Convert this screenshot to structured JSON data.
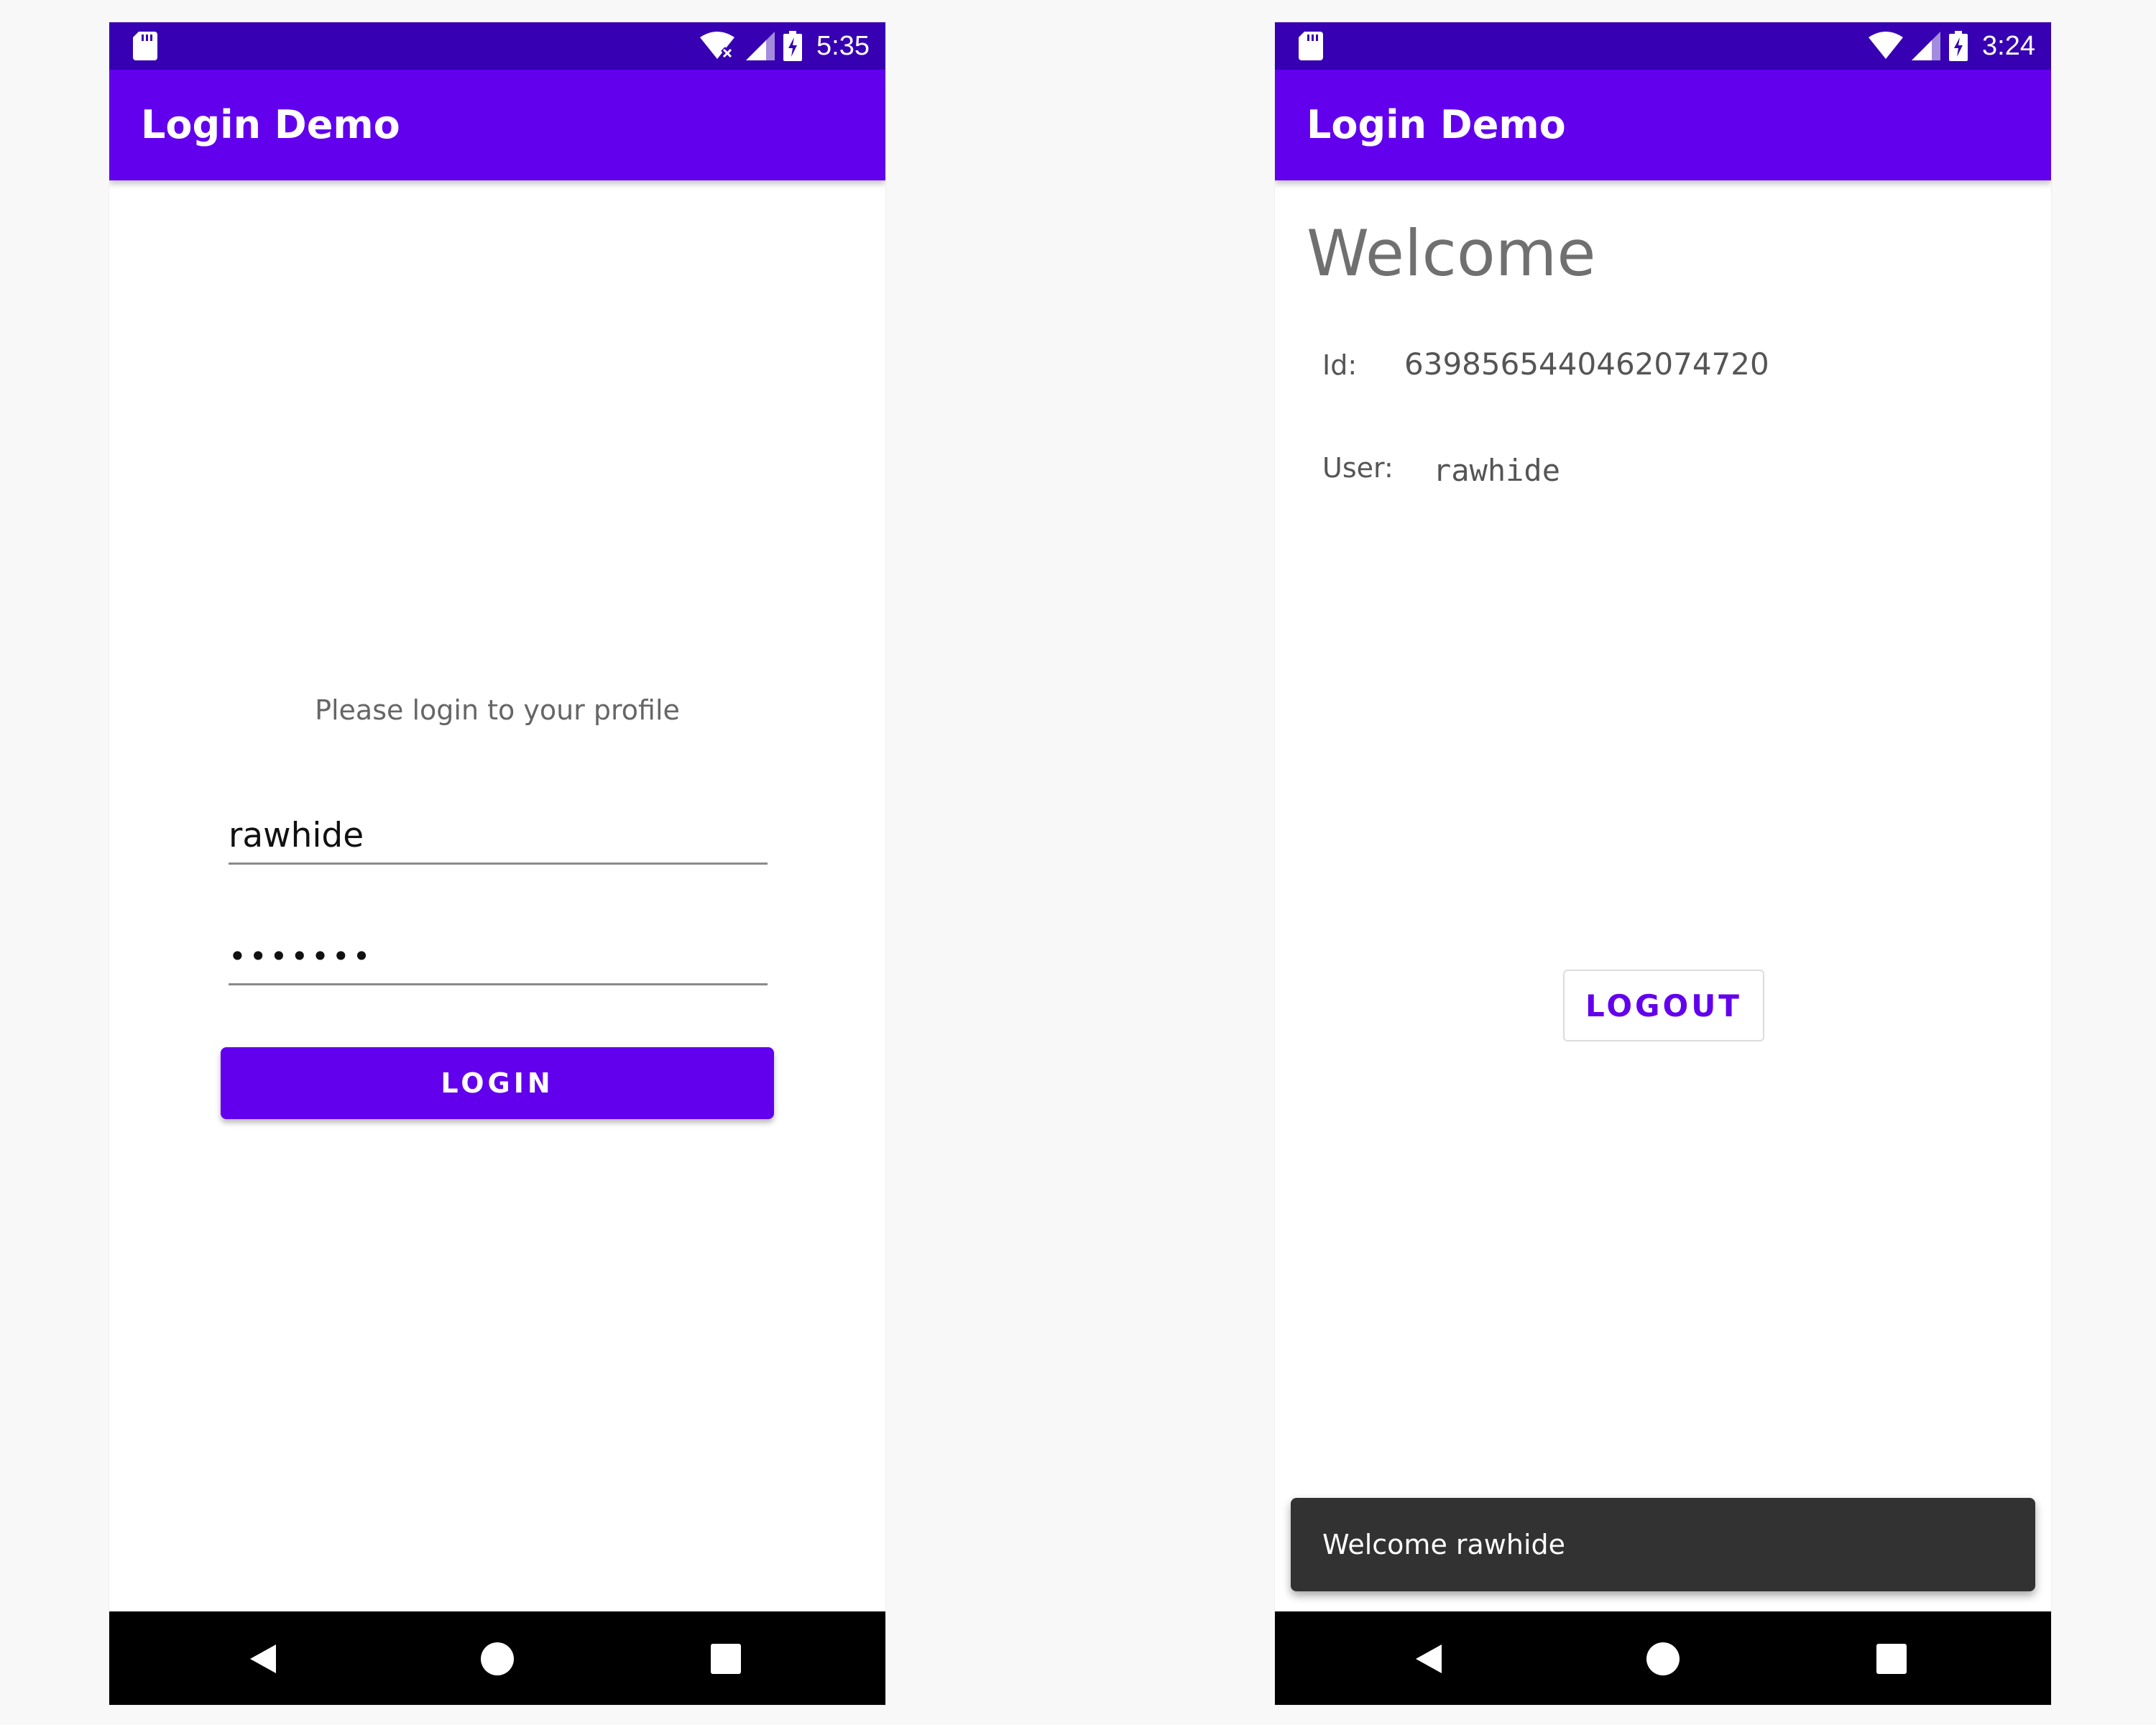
{
  "colors": {
    "status_bar": "#3700b3",
    "app_bar": "#6200ee",
    "accent": "#6200ee",
    "snackbar": "#323232",
    "nav_bar": "#000000"
  },
  "login_screen": {
    "status": {
      "time": "5:35",
      "icons": [
        "sd-card-icon",
        "wifi-x-icon",
        "cell-signal-icon",
        "battery-charging-icon"
      ]
    },
    "app_title": "Login Demo",
    "prompt": "Please login to your profile",
    "username_value": "rawhide",
    "password_value": "•••••••",
    "login_label": "LOGIN"
  },
  "profile_screen": {
    "status": {
      "time": "3:24",
      "icons": [
        "sd-card-icon",
        "wifi-icon",
        "cell-signal-icon",
        "battery-charging-icon"
      ]
    },
    "app_title": "Login Demo",
    "heading": "Welcome",
    "id_label": "Id:",
    "id_value": "6398565440462074720",
    "user_label": "User:",
    "user_value": "rawhide",
    "logout_label": "LOGOUT",
    "snackbar_text": "Welcome rawhide"
  },
  "nav": {
    "icons": [
      "back-icon",
      "home-icon",
      "recents-icon"
    ]
  }
}
